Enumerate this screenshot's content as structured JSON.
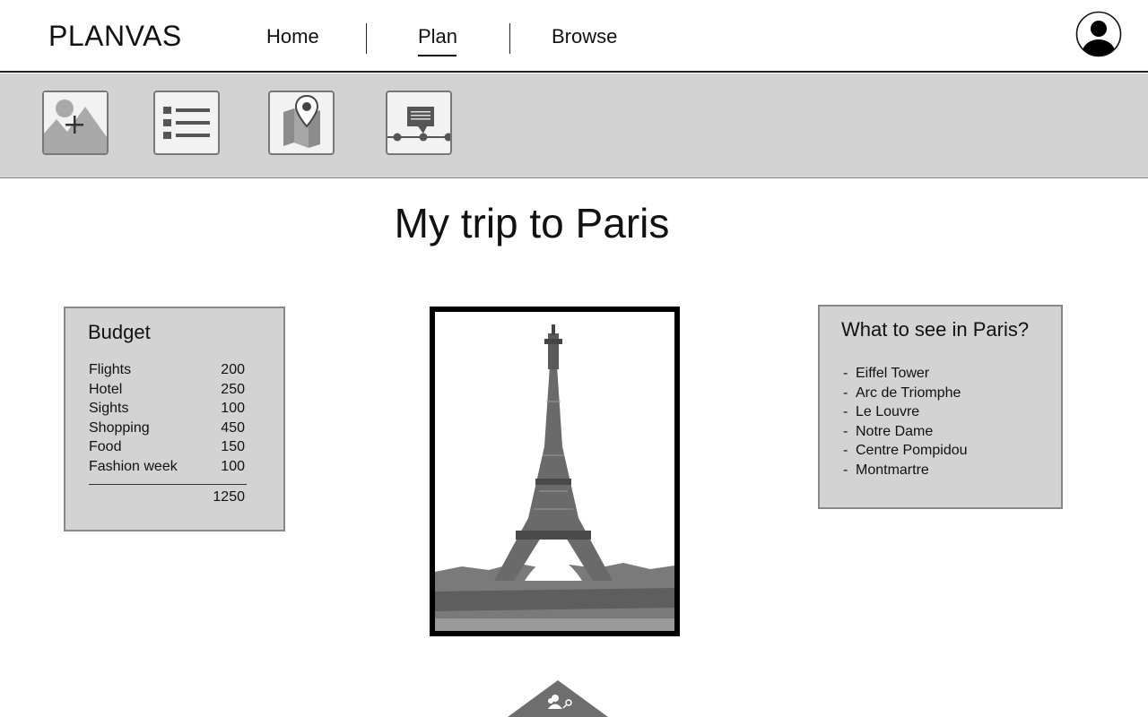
{
  "app": {
    "name": "PLANVAS"
  },
  "nav": {
    "items": [
      {
        "label": "Home"
      },
      {
        "label": "Plan",
        "active": true
      },
      {
        "label": "Browse"
      }
    ]
  },
  "header": {
    "avatar_icon": "user-avatar-icon"
  },
  "toolbar": {
    "tools": [
      {
        "icon": "add-image-icon"
      },
      {
        "icon": "list-icon"
      },
      {
        "icon": "map-pin-icon"
      },
      {
        "icon": "timeline-comment-icon"
      }
    ]
  },
  "page": {
    "title": "My trip to Paris"
  },
  "budget": {
    "title": "Budget",
    "items": [
      {
        "name": "Flights",
        "amount": "200"
      },
      {
        "name": "Hotel",
        "amount": "250"
      },
      {
        "name": "Sights",
        "amount": "100"
      },
      {
        "name": "Shopping",
        "amount": "450"
      },
      {
        "name": "Food",
        "amount": "150"
      },
      {
        "name": "Fashion week",
        "amount": "100"
      }
    ],
    "total": "1250"
  },
  "photo": {
    "subject": "eiffel-tower-photo"
  },
  "sights": {
    "title": "What to see in Paris?",
    "bullet": "-",
    "items": [
      "Eiffel Tower",
      "Arc de Triomphe",
      "Le Louvre",
      "Notre Dame",
      "Centre Pompidou",
      "Montmartre"
    ]
  },
  "bottom_tab": {
    "icon": "people-search-icon"
  },
  "colors": {
    "toolbar_bg": "#d3d3d3",
    "card_bg": "#d3d3d3",
    "icon_gray": "#666666",
    "text": "#111111"
  }
}
